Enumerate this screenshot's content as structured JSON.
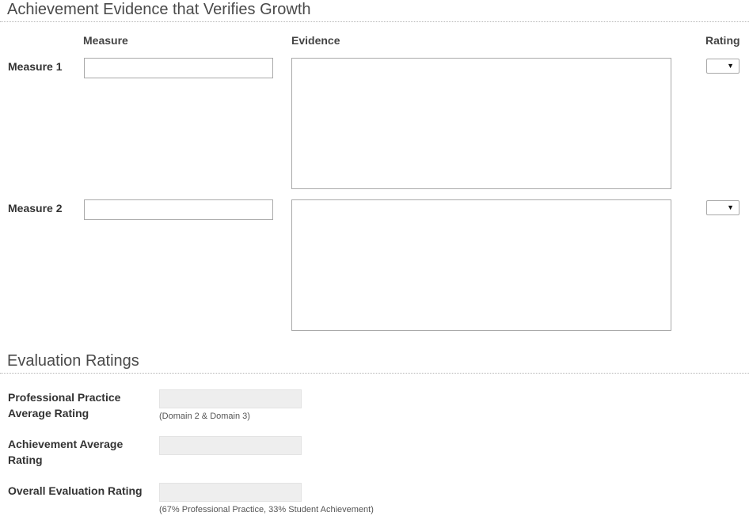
{
  "achievement": {
    "title": "Achievement Evidence that Verifies Growth",
    "headers": {
      "measure": "Measure",
      "evidence": "Evidence",
      "rating": "Rating"
    },
    "rows": [
      {
        "label": "Measure 1",
        "measure_value": "",
        "evidence_value": "",
        "rating_value": ""
      },
      {
        "label": "Measure 2",
        "measure_value": "",
        "evidence_value": "",
        "rating_value": ""
      }
    ]
  },
  "evaluation": {
    "title": "Evaluation Ratings",
    "items": [
      {
        "label": "Professional Practice Average Rating",
        "value": "",
        "hint": "(Domain 2 & Domain 3)"
      },
      {
        "label": "Achievement Average Rating",
        "value": "",
        "hint": ""
      },
      {
        "label": "Overall Evaluation Rating",
        "value": "",
        "hint": "(67% Professional Practice, 33% Student Achievement)"
      }
    ]
  },
  "icons": {
    "dropdown_arrow": "▼"
  }
}
